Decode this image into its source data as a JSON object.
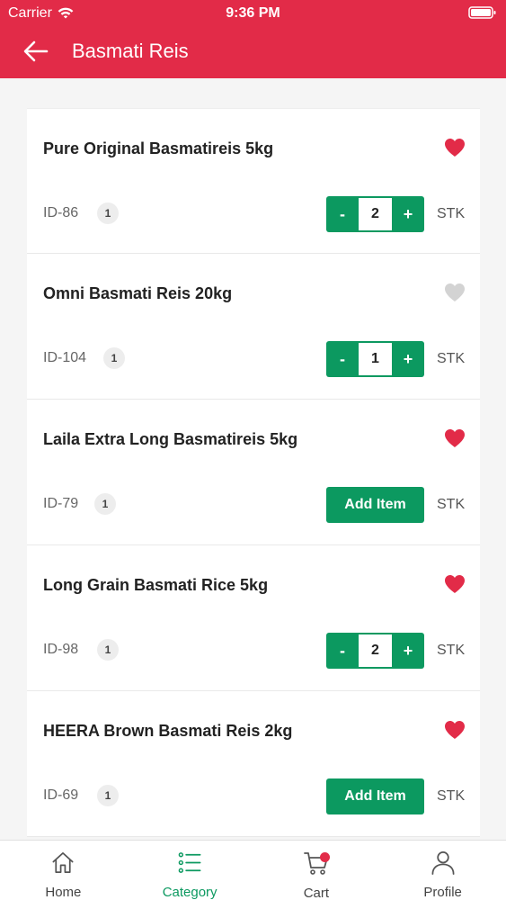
{
  "status_bar": {
    "carrier": "Carrier",
    "time": "9:36 PM"
  },
  "header": {
    "title": "Basmati Reis",
    "back_icon": "arrow-left-icon",
    "color": "#e22b48"
  },
  "products": [
    {
      "name": "Pure Original Basmatireis 5kg",
      "id": "ID-86",
      "badge": "1",
      "favorite": true,
      "quantity": "2",
      "unit": "STK",
      "minus": "-",
      "plus": "+",
      "add_label": ""
    },
    {
      "name": "Omni Basmati Reis 20kg",
      "id": "ID-104",
      "badge": "1",
      "favorite": false,
      "quantity": "1",
      "unit": "STK",
      "minus": "-",
      "plus": "+",
      "add_label": ""
    },
    {
      "name": "Laila Extra Long Basmatireis 5kg",
      "id": "ID-79",
      "badge": "1",
      "favorite": true,
      "quantity": "",
      "unit": "STK",
      "minus": "",
      "plus": "",
      "add_label": "Add Item"
    },
    {
      "name": "Long Grain Basmati Rice 5kg",
      "id": "ID-98",
      "badge": "1",
      "favorite": true,
      "quantity": "2",
      "unit": "STK",
      "minus": "-",
      "plus": "+",
      "add_label": ""
    },
    {
      "name": "HEERA Brown Basmati Reis 2kg",
      "id": "ID-69",
      "badge": "1",
      "favorite": true,
      "quantity": "",
      "unit": "STK",
      "minus": "",
      "plus": "",
      "add_label": "Add Item"
    }
  ],
  "tabs": [
    {
      "label": "Home",
      "icon": "home-icon",
      "active": false
    },
    {
      "label": "Category",
      "icon": "list-icon",
      "active": true
    },
    {
      "label": "Cart",
      "icon": "cart-icon",
      "active": false
    },
    {
      "label": "Profile",
      "icon": "person-icon",
      "active": false
    }
  ],
  "colors": {
    "accent": "#e22b48",
    "primary_green": "#0c9960",
    "heart_active": "#e22b48",
    "heart_inactive": "#d3d3d3"
  }
}
